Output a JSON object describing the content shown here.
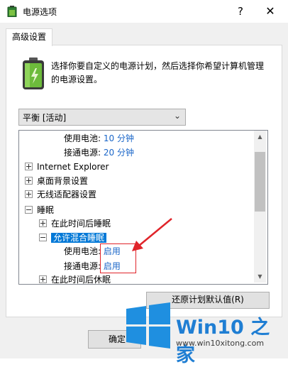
{
  "window": {
    "title": "电源选项",
    "help_label": "?",
    "close_label": "✕"
  },
  "tab": {
    "label": "高级设置"
  },
  "description": "选择你要自定义的电源计划，然后选择你希望计算机管理的电源设置。",
  "plan_select": {
    "value": "平衡 [活动]"
  },
  "tree": {
    "rows": [
      {
        "label": "使用电池:",
        "value": "10 分钟"
      },
      {
        "label": "接通电源:",
        "value": "20 分钟"
      },
      {
        "label": "Internet Explorer"
      },
      {
        "label": "桌面背景设置"
      },
      {
        "label": "无线适配器设置"
      },
      {
        "label": "睡眠"
      },
      {
        "label": "在此时间后睡眠"
      },
      {
        "label": "允许混合睡眠"
      },
      {
        "label": "使用电池:",
        "value": "启用"
      },
      {
        "label": "接通电源:",
        "value": "启用"
      },
      {
        "label": "在此时间后休眠"
      }
    ]
  },
  "buttons": {
    "restore": "还原计划默认值(R)",
    "ok": "确定"
  },
  "watermark": {
    "title": "Win10 之家",
    "url": "www.win10xitong.com"
  },
  "colors": {
    "selection": "#0078d7",
    "value_blue": "#1a66c8",
    "annotation_red": "#e0242a",
    "watermark_blue": "#1f7ed3"
  }
}
